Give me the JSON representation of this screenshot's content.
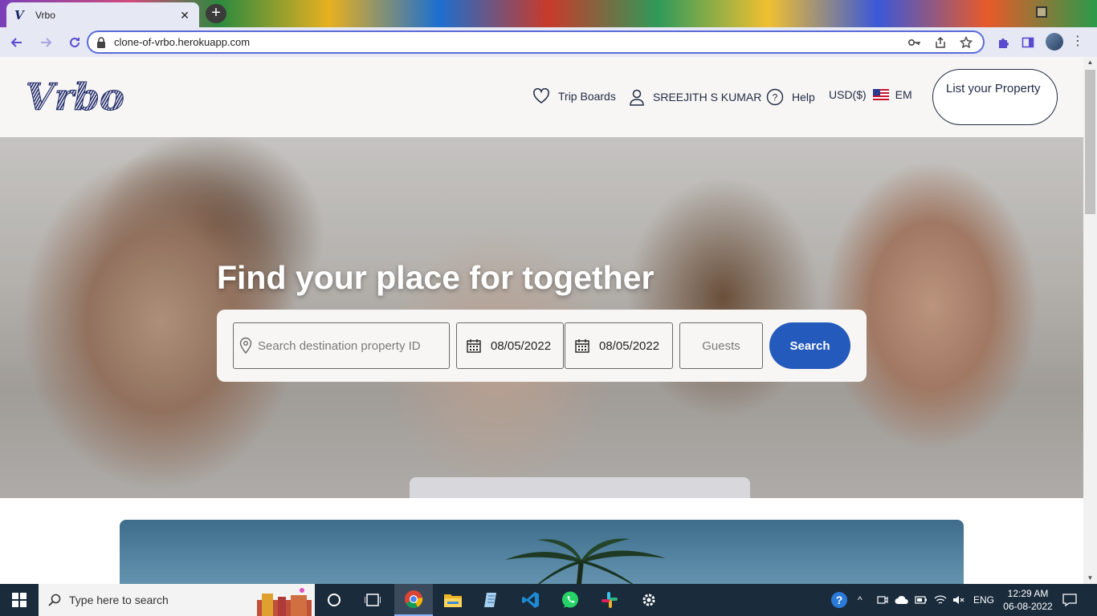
{
  "browser": {
    "tab_title": "Vrbo",
    "tab_favicon_letter": "V",
    "url": "clone-of-vrbo.herokuapp.com"
  },
  "header": {
    "logo_text": "Vrbo",
    "nav": {
      "trip_boards": "Trip Boards",
      "user_name": "SREEJITH S KUMAR",
      "help": "Help",
      "currency": "USD($)",
      "language": "EM"
    },
    "list_property": "List your Property"
  },
  "hero": {
    "title": "Find your place for together",
    "search": {
      "destination_placeholder": "Search destination property ID",
      "checkin": "08/05/2022",
      "checkout": "08/05/2022",
      "guests_placeholder": "Guests",
      "button": "Search"
    }
  },
  "taskbar": {
    "search_placeholder": "Type here to search",
    "language": "ENG",
    "time": "12:29 AM",
    "date": "06-08-2022",
    "apps": [
      "cortana-icon",
      "task-view-icon",
      "chrome-icon",
      "file-explorer-icon",
      "notepad-icon",
      "vscode-icon",
      "whatsapp-icon",
      "slack-icon",
      "settings-icon"
    ]
  },
  "colors": {
    "brand_navy": "#1f2a44",
    "search_button": "#245abc",
    "header_bg": "#f8f6f4",
    "taskbar_bg": "#1a2b3c"
  }
}
